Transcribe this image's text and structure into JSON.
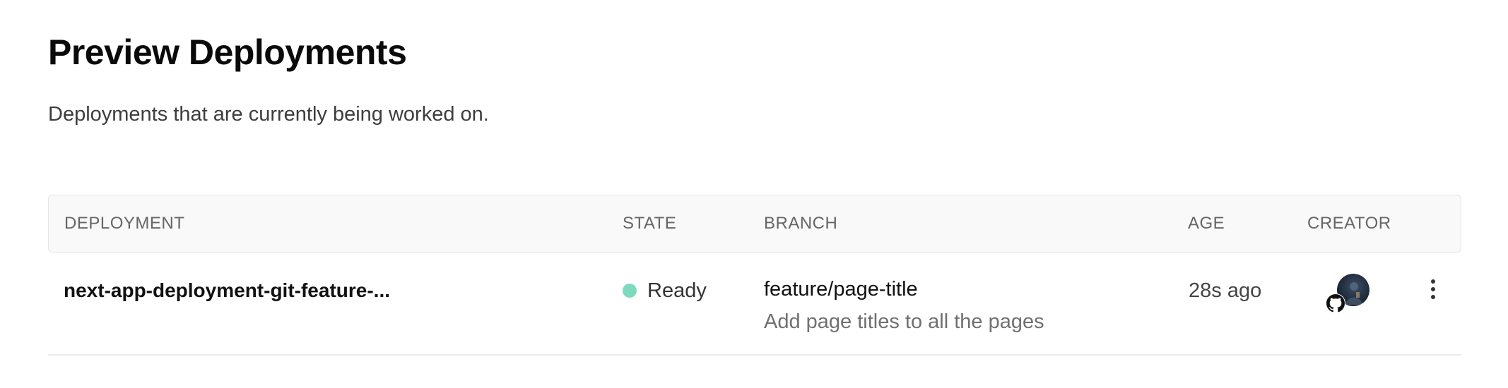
{
  "header": {
    "title": "Preview Deployments",
    "subtitle": "Deployments that are currently being worked on."
  },
  "table": {
    "columns": [
      "DEPLOYMENT",
      "STATE",
      "BRANCH",
      "AGE",
      "CREATOR"
    ],
    "rows": [
      {
        "deployment": "next-app-deployment-git-feature-...",
        "state": "Ready",
        "state_color": "#7ed9be",
        "branch": "feature/page-title",
        "commit_message": "Add page titles to all the pages",
        "age": "28s ago",
        "creator_avatar_icon": "user-avatar",
        "creator_badge_icon": "github-icon",
        "menu_icon": "more-vertical-icon"
      }
    ]
  }
}
